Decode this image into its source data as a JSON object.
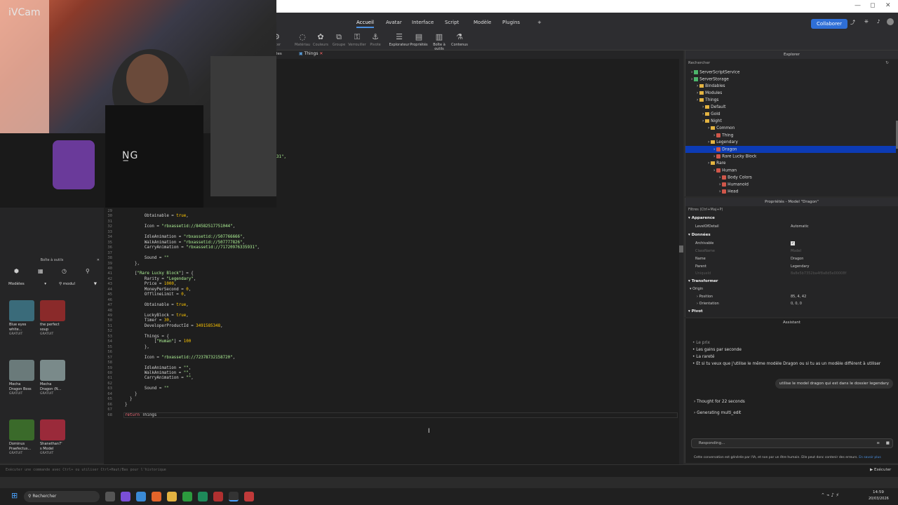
{
  "webcam": {
    "label": "iVCam"
  },
  "window_controls": [
    "—",
    "◻",
    "✕"
  ],
  "ribbon": {
    "tabs": [
      "Accueil",
      "Avatar",
      "Interface",
      "Script",
      "Modèle",
      "Plugins",
      "+"
    ],
    "active_tab": "Accueil",
    "collaborate_label": "Collaborer"
  },
  "toolbar": {
    "items": [
      "Matériau",
      "Couleurs",
      "Groupe",
      "Verrouiller",
      "Pivote",
      "Explorateur",
      "Propriétés",
      "Boîte à outils",
      "Contenus"
    ],
    "left_fragment": "orter"
  },
  "doc_tabs": {
    "left_fragment": "les",
    "active": "Things",
    "close": "✕"
  },
  "editor": {
    "stray_fragment": "31\",",
    "lines": [
      {
        "n": "29",
        "text": ""
      },
      {
        "n": "30",
        "text": "        Obtainable = true,"
      },
      {
        "n": "31",
        "text": ""
      },
      {
        "n": "32",
        "text": "        Icon = \"rbxassetid://84582517751044\","
      },
      {
        "n": "33",
        "text": ""
      },
      {
        "n": "34",
        "text": "        IdleAnimation = \"rbxassetid://507766666\","
      },
      {
        "n": "35",
        "text": "        WalkAnimation = \"rbxassetid://507777826\","
      },
      {
        "n": "36",
        "text": "        CarryAnimation = \"rbxassetid://71720976335931\","
      },
      {
        "n": "37",
        "text": ""
      },
      {
        "n": "38",
        "text": "        Sound = \"\""
      },
      {
        "n": "39",
        "text": "    },"
      },
      {
        "n": "40",
        "text": ""
      },
      {
        "n": "41",
        "text": "    [\"Rare Lucky Block\"] = {"
      },
      {
        "n": "42",
        "text": "        Rarity = \"Legendary\","
      },
      {
        "n": "43",
        "text": "        Price = 1000,"
      },
      {
        "n": "44",
        "text": "        MoneyPerSecond = 0,"
      },
      {
        "n": "45",
        "text": "        OfflineLimit = 0,"
      },
      {
        "n": "46",
        "text": ""
      },
      {
        "n": "47",
        "text": "        Obtainable = true,"
      },
      {
        "n": "48",
        "text": ""
      },
      {
        "n": "49",
        "text": "        LuckyBlock = true,"
      },
      {
        "n": "50",
        "text": "        Timer = 30,"
      },
      {
        "n": "51",
        "text": "        DeveloperProductId = 3491585348,"
      },
      {
        "n": "52",
        "text": ""
      },
      {
        "n": "53",
        "text": "        Things = {"
      },
      {
        "n": "54",
        "text": "            [\"Human\"] = 100"
      },
      {
        "n": "55",
        "text": "        },"
      },
      {
        "n": "56",
        "text": ""
      },
      {
        "n": "57",
        "text": "        Icon = \"rbxassetid://72378732158720\","
      },
      {
        "n": "58",
        "text": ""
      },
      {
        "n": "59",
        "text": "        IdleAnimation = \"\","
      },
      {
        "n": "60",
        "text": "        WalkAnimation = \"\","
      },
      {
        "n": "61",
        "text": "        CarryAnimation = \"\","
      },
      {
        "n": "62",
        "text": ""
      },
      {
        "n": "63",
        "text": "        Sound = \"\""
      },
      {
        "n": "64",
        "text": "    }"
      },
      {
        "n": "65",
        "text": "  }"
      },
      {
        "n": "66",
        "text": "}"
      },
      {
        "n": "67",
        "text": ""
      },
      {
        "n": "68",
        "text": "return Things"
      }
    ]
  },
  "toolbox": {
    "title": "Boîte à outils",
    "category": "Modèles",
    "search": "modul",
    "items": [
      {
        "name1": "Blue eyes",
        "name2": "white...",
        "price": "GRATUIT",
        "color": "#3a6b7a"
      },
      {
        "name1": "the perfect",
        "name2": "soup",
        "price": "GRATUIT",
        "color": "#8a2a2a"
      },
      {
        "name1": "Mecha",
        "name2": "Dragon Boss",
        "price": "GRATUIT",
        "color": "#6a7a7a"
      },
      {
        "name1": "Mecha",
        "name2": "Dragon (N...",
        "price": "GRATUIT",
        "color": "#7a8a8a"
      },
      {
        "name1": "Dominus",
        "name2": "Praefectus...",
        "price": "GRATUIT",
        "color": "#3a6a2a"
      },
      {
        "name1": "Shanethan7'",
        "name2": "s Model",
        "price": "GRATUIT",
        "color": "#9a2a3a"
      }
    ]
  },
  "explorer": {
    "title": "Explorer",
    "search": "Rechercher",
    "nodes": [
      {
        "label": "ServerScriptService",
        "depth": 0,
        "kind": "srv"
      },
      {
        "label": "ServerStorage",
        "depth": 0,
        "kind": "srv"
      },
      {
        "label": "Bindables",
        "depth": 1,
        "kind": "fold"
      },
      {
        "label": "Modules",
        "depth": 1,
        "kind": "fold"
      },
      {
        "label": "Things",
        "depth": 1,
        "kind": "fold"
      },
      {
        "label": "Default",
        "depth": 2,
        "kind": "fold"
      },
      {
        "label": "Gold",
        "depth": 2,
        "kind": "fold"
      },
      {
        "label": "Night",
        "depth": 2,
        "kind": "fold"
      },
      {
        "label": "Common",
        "depth": 3,
        "kind": "fold"
      },
      {
        "label": "Thing",
        "depth": 4,
        "kind": "mdl"
      },
      {
        "label": "Legendary",
        "depth": 3,
        "kind": "fold"
      },
      {
        "label": "Dragon",
        "depth": 4,
        "kind": "mdl"
      },
      {
        "label": "Rare Lucky Block",
        "depth": 4,
        "kind": "mdl"
      },
      {
        "label": "Rare",
        "depth": 3,
        "kind": "fold"
      },
      {
        "label": "Human",
        "depth": 4,
        "kind": "mdl"
      },
      {
        "label": "Body Colors",
        "depth": 5,
        "kind": "mdl"
      },
      {
        "label": "Humanoid",
        "depth": 5,
        "kind": "mdl"
      },
      {
        "label": "Head",
        "depth": 5,
        "kind": "mdl"
      }
    ]
  },
  "properties": {
    "title": "Propriétés - Model \"Dragon\"",
    "filter": "Filtres (Ctrl+Maj+P)",
    "sections": {
      "apparence": "Apparence",
      "donnees": "Données",
      "transformer": "Transformer",
      "pivot": "Pivot"
    },
    "rows": {
      "lod": {
        "k": "LevelOfDetail",
        "v": "Automatic"
      },
      "archivable": {
        "k": "Archivable",
        "v": "✓"
      },
      "classname": {
        "k": "ClassName",
        "v": "Model"
      },
      "name": {
        "k": "Name",
        "v": "Dragon"
      },
      "parent": {
        "k": "Parent",
        "v": "Legendary"
      },
      "uniqueid": {
        "k": "UniqueId",
        "v": "8a8e5b7352ba4f8a8d5e00008f"
      },
      "origin": {
        "k": "Origin",
        "v": ""
      },
      "position": {
        "k": "Position",
        "v": "85, 4, 42"
      },
      "orientation": {
        "k": "Orientation",
        "v": "0, 0, 0"
      }
    }
  },
  "assistant": {
    "title": "Assistant",
    "lines": [
      "Le prix",
      "Les gains par seconde",
      "La rareté",
      "Et si tu veux que j'utilise le même modèle Dragon ou si tu as un modèle différent à utiliser"
    ],
    "user_message": "utilise le model dragon qui est dans le dossier legendary",
    "steps": [
      "Thought for 22 seconds",
      "Generating multi_edit"
    ],
    "input": "Responding...",
    "disclaimer": "Cette conversation est générée par l'IA, et non par un être humain. Elle peut donc contenir des erreurs.",
    "disclaimer_link": "En savoir plus"
  },
  "cmdbar": {
    "placeholder": "Exécuter une commande avec Ctrl+ ou utiliser Ctrl+Haut/Bas pour l'historique",
    "run_label": "Exécuter"
  },
  "taskbar": {
    "search": "Rechercher",
    "time": "14:59",
    "date": "20/03/2026"
  }
}
